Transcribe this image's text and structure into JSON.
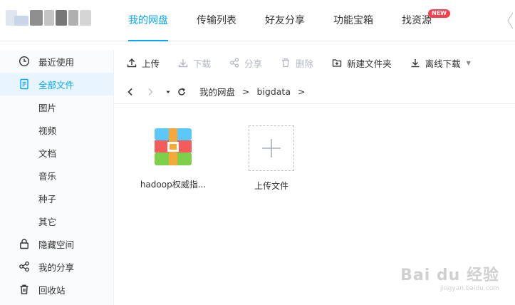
{
  "header": {
    "tabs": [
      {
        "label": "我的网盘",
        "active": true
      },
      {
        "label": "传输列表"
      },
      {
        "label": "好友分享"
      },
      {
        "label": "功能宝箱"
      },
      {
        "label": "找资源",
        "badge": "NEW"
      }
    ]
  },
  "sidebar": {
    "items": [
      {
        "label": "最近使用",
        "icon": "clock-icon"
      },
      {
        "label": "全部文件",
        "icon": "document-icon",
        "active": true
      },
      {
        "label": "图片"
      },
      {
        "label": "视频"
      },
      {
        "label": "文档"
      },
      {
        "label": "音乐"
      },
      {
        "label": "种子"
      },
      {
        "label": "其它"
      },
      {
        "label": "隐藏空间",
        "icon": "lock-icon"
      },
      {
        "label": "我的分享",
        "icon": "share-icon"
      },
      {
        "label": "回收站",
        "icon": "trash-icon"
      }
    ]
  },
  "toolbar": {
    "upload": "上传",
    "download": "下载",
    "share": "分享",
    "delete": "删除",
    "new_folder": "新建文件夹",
    "offline_download": "离线下载"
  },
  "path": {
    "crumbs": [
      "我的网盘",
      "bigdata"
    ],
    "separator": ">"
  },
  "files": [
    {
      "name": "hadoop权威指...",
      "icon": "archive-icon"
    }
  ],
  "upload_tile": {
    "label": "上传文件"
  },
  "watermark": {
    "text": "Bai du 经验",
    "sub": "jingyan.baidu.com"
  },
  "colors": {
    "accent": "#06a7ff",
    "badge": "#f5404b",
    "active_bg": "#e8f5fe"
  }
}
